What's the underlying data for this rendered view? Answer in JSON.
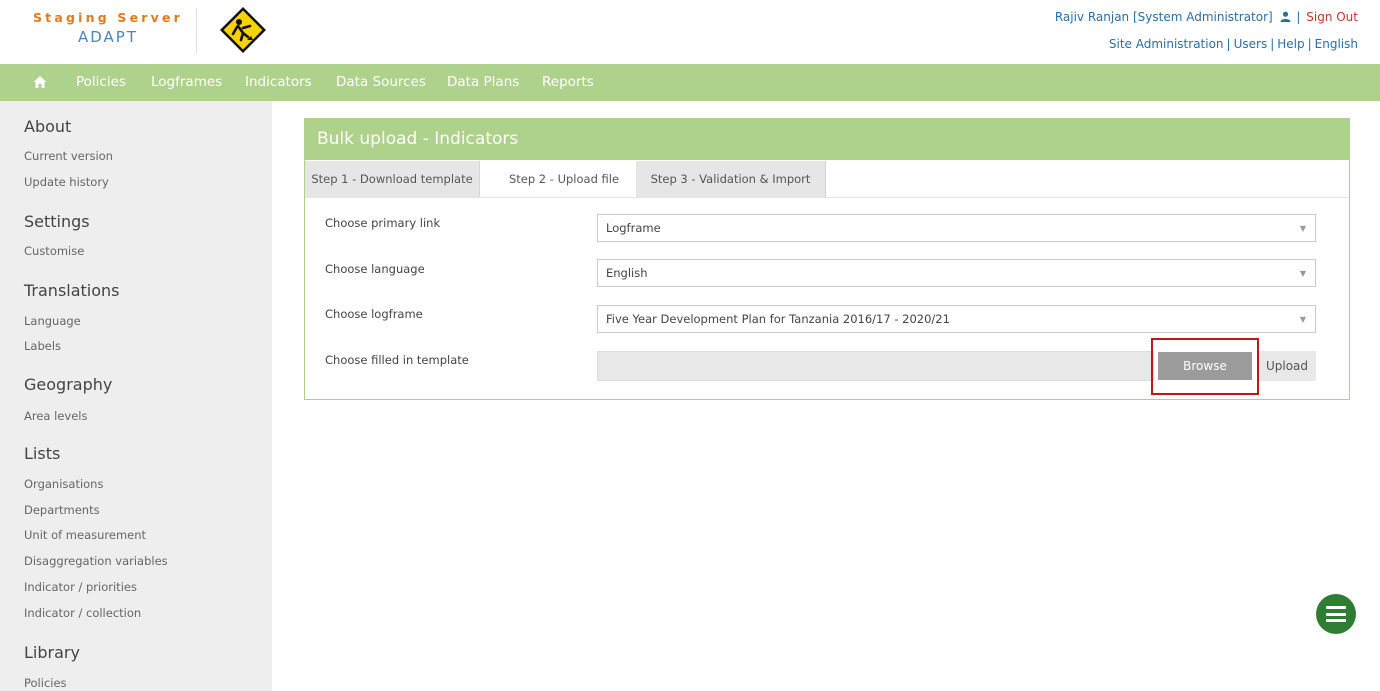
{
  "header": {
    "brand_top": "Staging Server",
    "brand_bottom": "ADAPT",
    "user": "Rajiv Ranjan [System Administrator]",
    "sign_out": "Sign Out",
    "links": [
      "Site Administration",
      "Users",
      "Help",
      "English"
    ]
  },
  "nav": {
    "items": [
      "Policies",
      "Logframes",
      "Indicators",
      "Data Sources",
      "Data Plans",
      "Reports"
    ]
  },
  "sidebar": {
    "sections": [
      {
        "title": "About",
        "items": [
          "Current version",
          "Update history"
        ]
      },
      {
        "title": "Settings",
        "items": [
          "Customise"
        ]
      },
      {
        "title": "Translations",
        "items": [
          "Language",
          "Labels"
        ]
      },
      {
        "title": "Geography",
        "items": [
          "Area levels"
        ]
      },
      {
        "title": "Lists",
        "items": [
          "Organisations",
          "Departments",
          "Unit of measurement",
          "Disaggregation variables",
          "Indicator / priorities",
          "Indicator / collection"
        ]
      },
      {
        "title": "Library",
        "items": [
          "Policies"
        ]
      }
    ]
  },
  "panel": {
    "title": "Bulk upload - Indicators",
    "tabs": [
      "Step 1 - Download template",
      "Step 2 - Upload file",
      "Step 3 - Validation & Import"
    ],
    "active_tab": 1,
    "fields": {
      "primary_link": {
        "label": "Choose primary link",
        "value": "Logframe"
      },
      "language": {
        "label": "Choose language",
        "value": "English"
      },
      "logframe": {
        "label": "Choose logframe",
        "value": "Five Year Development Plan for Tanzania 2016/17 - 2020/21"
      },
      "template": {
        "label": "Choose filled in template",
        "value": ""
      }
    },
    "browse_label": "Browse",
    "upload_label": "Upload"
  },
  "colors": {
    "nav_green": "#aed28b",
    "brand_orange": "#e07b1f",
    "brand_blue": "#4f86b4",
    "link_blue": "#2a6ea6",
    "highlight_red": "#c0161c",
    "fab_green": "#2e7d32"
  },
  "icons": [
    "home-icon",
    "user-icon",
    "construction-warning-icon",
    "menu-icon",
    "dropdown-caret-icon"
  ]
}
